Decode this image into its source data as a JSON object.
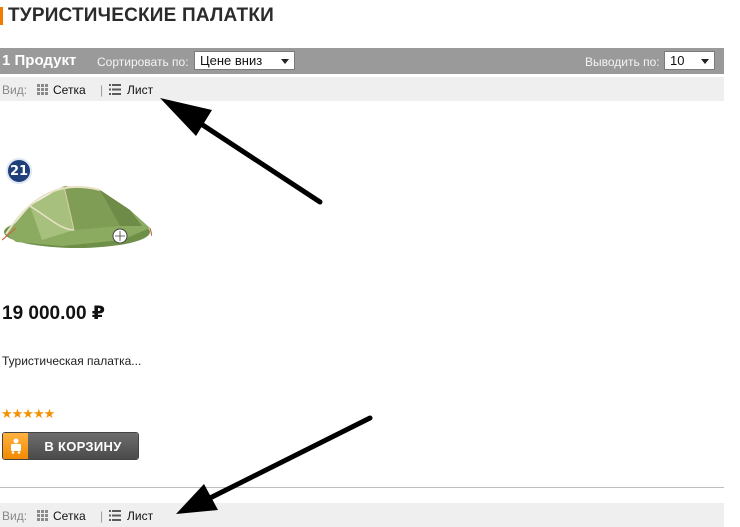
{
  "page": {
    "title": "ТУРИСТИЧЕСКИЕ ПАЛАТКИ",
    "accent_color": "#f07d00"
  },
  "toolbar": {
    "count": "1 Продукт",
    "sort_label": "Сортировать по:",
    "sort_value": "Цене вниз",
    "limit_label": "Выводить по:",
    "limit_value": "10"
  },
  "view_top": {
    "label": "Вид:",
    "grid": "Сетка",
    "separator": "|",
    "list": "Лист"
  },
  "view_bottom": {
    "label": "Вид:",
    "grid": "Сетка",
    "separator": "|",
    "list": "Лист"
  },
  "product": {
    "badge": "21",
    "image_icon": "tent-image",
    "price": "19 000.00 ₽",
    "description": "Туристическая палатка...",
    "rating_stars": "★★★★★",
    "rating": 5,
    "rating_max": 5,
    "cart_label": "В КОРЗИНУ",
    "cart_icon": "cart-icon"
  },
  "annotations": {
    "arrow_color": "#000000",
    "arrow_icon": "arrow-annotation"
  }
}
